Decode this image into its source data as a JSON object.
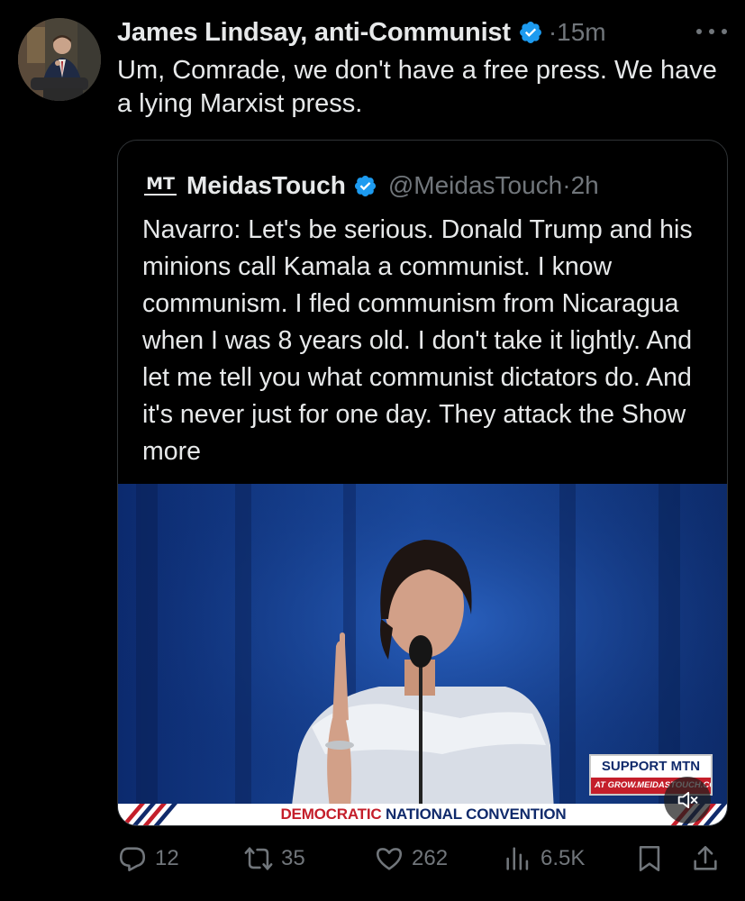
{
  "tweet": {
    "author": {
      "name": "James Lindsay, anti-Communist",
      "avatar": "avatar-photo",
      "verified": true
    },
    "separator": "·",
    "time": "15m",
    "text": "Um, Comrade, we don't have a free press. We have a lying Marxist press.",
    "more_icon": "more-horizontal-icon"
  },
  "quote": {
    "logo_text": "MT",
    "name": "MeidasTouch",
    "verified": true,
    "handle": "@MeidasTouch",
    "separator": "·",
    "time": "2h",
    "text": "Navarro: Let's be serious. Donald Trump and his minions call Kamala a communist. I know communism. I fled communism from Nicaragua when I was 8 years old. I don't take it lightly. And let me tell you what communist dictators do. And it's never just for one day. They attack the ",
    "show_more": "Show more",
    "media": {
      "overlay_support": "SUPPORT MTN",
      "overlay_url": "AT GROW.MEIDASTOUCH.COM",
      "banner_part1": "DEMOCRATIC",
      "banner_part2": " NATIONAL CONVENTION",
      "mute_icon": "speaker-muted-icon"
    }
  },
  "actions": {
    "replies": "12",
    "reposts": "35",
    "likes": "262",
    "views": "6.5K",
    "icons": [
      "reply-icon",
      "repost-icon",
      "like-icon",
      "views-icon",
      "bookmark-icon",
      "share-icon"
    ]
  },
  "colors": {
    "background": "#000000",
    "text": "#e7e9ea",
    "muted": "#71767b",
    "verified": "#1d9bf0",
    "border": "#2f3336"
  }
}
